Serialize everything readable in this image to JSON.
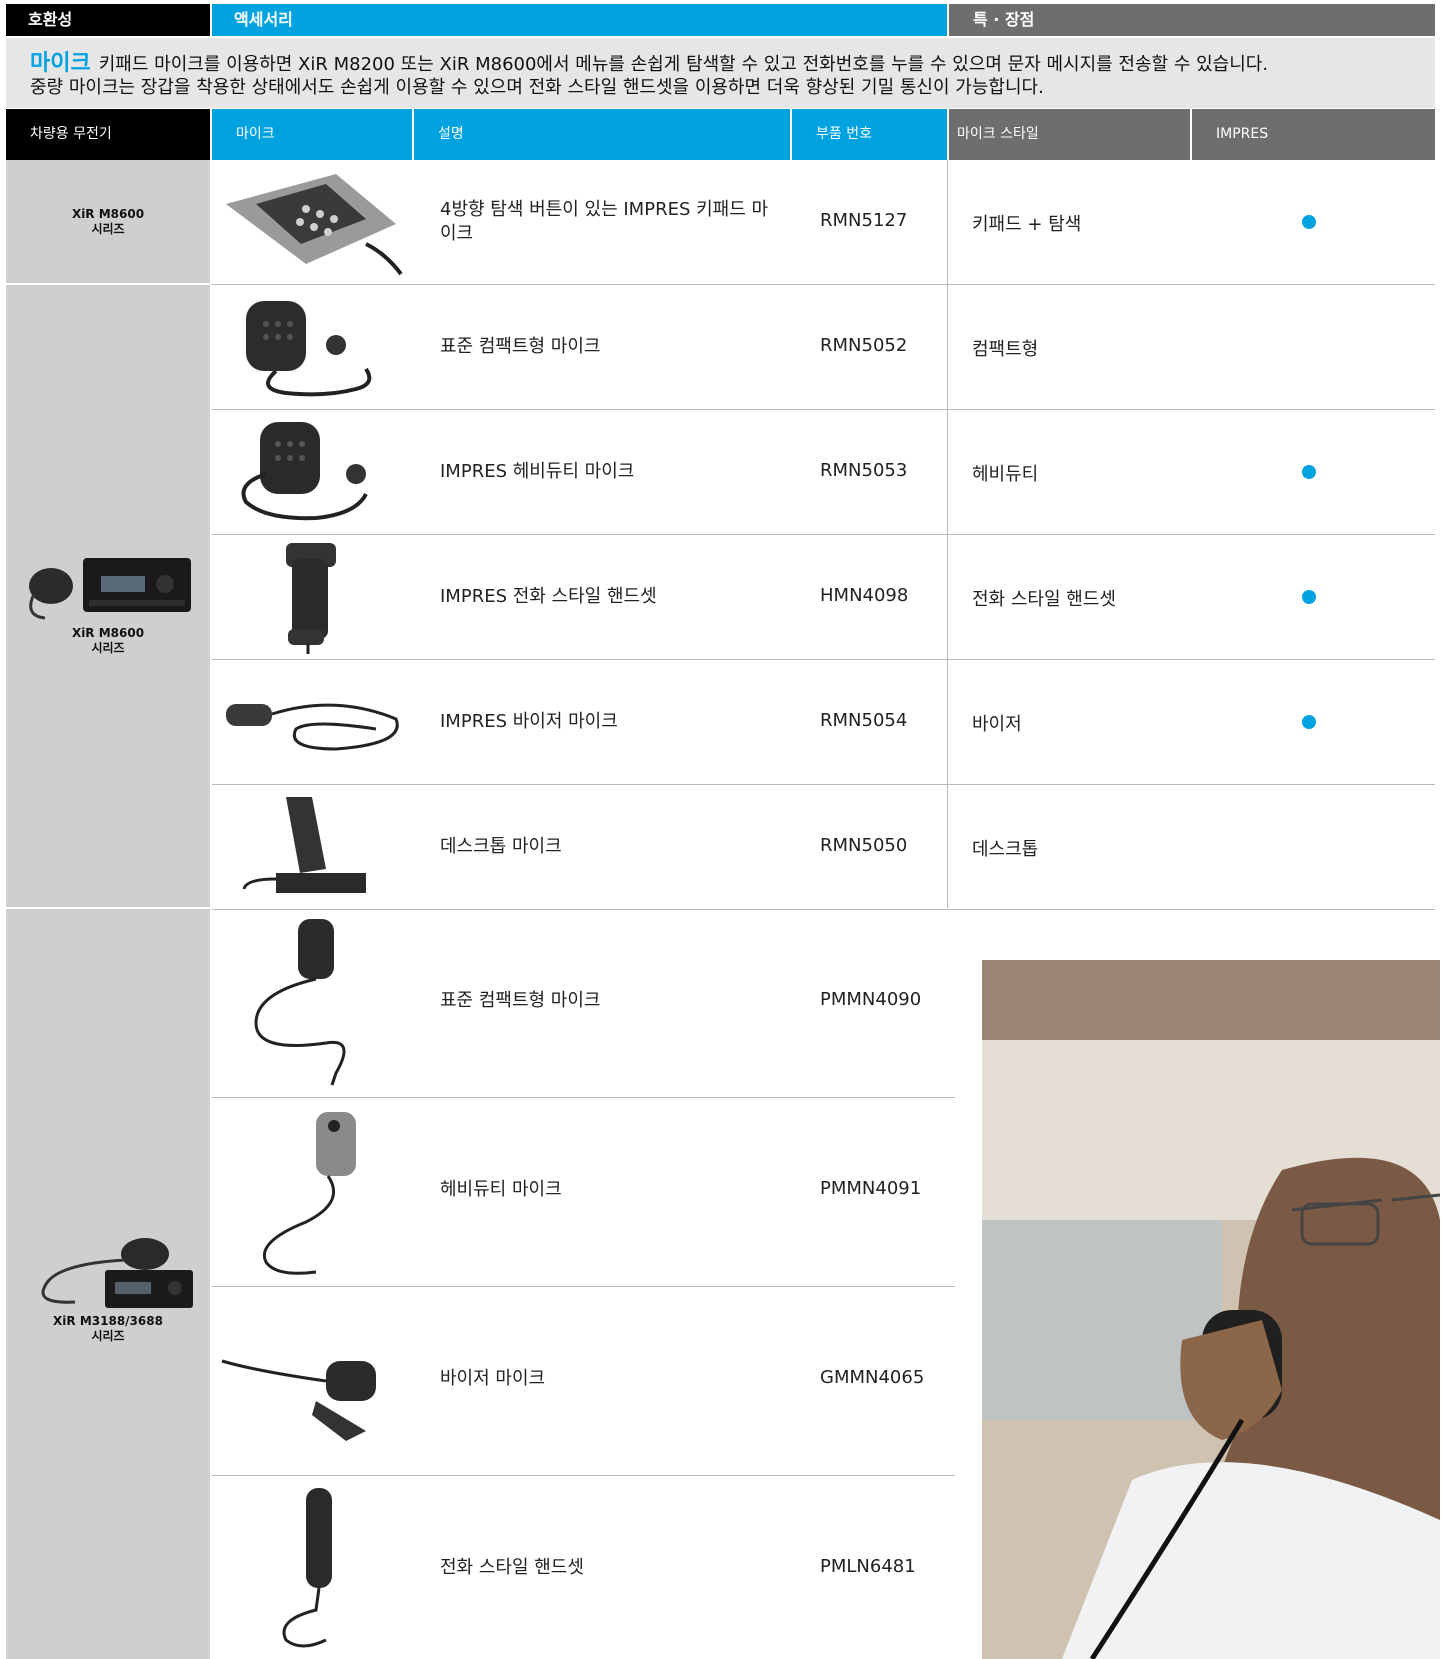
{
  "header": {
    "compat": "호환성",
    "accessories": "액세서리",
    "features": "특 · 장점"
  },
  "intro": {
    "lead": "마이크",
    "line1": "키패드 마이크를 이용하면 XiR M8200 또는 XiR M8600에서 메뉴를 손쉽게 탐색할 수 있고 전화번호를 누를 수 있으며 문자 메시지를 전송할 수 있습니다.",
    "line2": "중량 마이크는 장갑을 착용한 상태에서도 손쉽게 이용할 수 있으며 전화 스타일 핸드셋을 이용하면 더욱 향상된 기밀 통신이 가능합니다."
  },
  "columns": {
    "vehicle_radio": "차량용 무전기",
    "mic": "마이크",
    "description": "설명",
    "part_number": "부품 번호",
    "mic_style": "마이크 스타일",
    "impres": "IMPRES"
  },
  "compat": {
    "g1_name": "XiR M8600",
    "g1_sub": "시리즈",
    "g2_name": "XiR M8600",
    "g2_sub": "시리즈",
    "g3_name": "XiR M3188/3688",
    "g3_sub": "시리즈"
  },
  "rows": [
    {
      "description": "4방향 탐색 버튼이 있는 IMPRES 키패드 마이크",
      "part": "RMN5127",
      "style": "키패드 + 탐색",
      "impres": true,
      "icon": "keypad-mic"
    },
    {
      "description": "표준 컴팩트형 마이크",
      "part": "RMN5052",
      "style": "컴팩트형",
      "impres": false,
      "icon": "compact-mic"
    },
    {
      "description": "IMPRES 헤비듀티 마이크",
      "part": "RMN5053",
      "style": "헤비듀티",
      "impres": true,
      "icon": "heavy-duty-mic"
    },
    {
      "description": "IMPRES 전화 스타일 핸드셋",
      "part": "HMN4098",
      "style": "전화 스타일 핸드셋",
      "impres": true,
      "icon": "telephone-handset"
    },
    {
      "description": "IMPRES 바이저 마이크",
      "part": "RMN5054",
      "style": "바이저",
      "impres": true,
      "icon": "visor-mic"
    },
    {
      "description": "데스크톱 마이크",
      "part": "RMN5050",
      "style": "데스크톱",
      "impres": false,
      "icon": "desktop-mic"
    },
    {
      "description": "표준 컴팩트형 마이크",
      "part": "PMMN4090",
      "icon": "compact-mic"
    },
    {
      "description": "헤비듀티 마이크",
      "part": "PMMN4091",
      "icon": "heavy-duty-mic"
    },
    {
      "description": "바이저 마이크",
      "part": "GMMN4065",
      "icon": "visor-mic"
    },
    {
      "description": "전화 스타일 핸드셋",
      "part": "PMLN6481",
      "icon": "telephone-handset"
    }
  ],
  "colors": {
    "accent": "#00a3e0",
    "header_black": "#000000",
    "header_gray": "#6e6e6e",
    "compat_gray": "#cfcfcf",
    "intro_bg": "#e6e6e6"
  }
}
